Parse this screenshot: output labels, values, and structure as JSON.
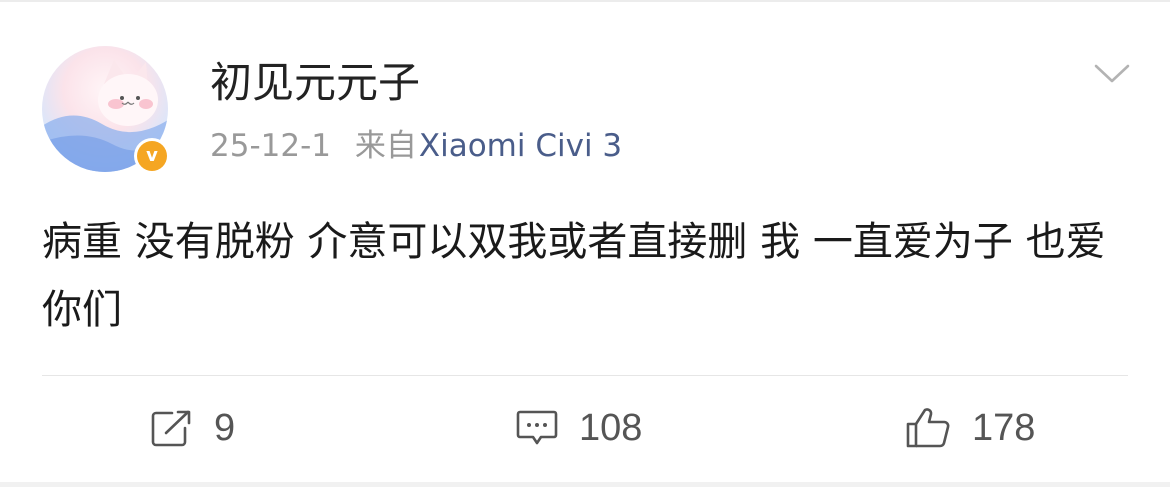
{
  "post": {
    "author": {
      "name": "初见元元子",
      "verified_badge": "v",
      "avatar_icon": "cat-avatar"
    },
    "meta": {
      "date": "25-12-1",
      "from_label": "来自",
      "device": "Xiaomi Civi 3"
    },
    "text": "病重 没有脱粉 介意可以双我或者直接删 我 一直爱为子 也爱你们",
    "actions": {
      "repost_count": "9",
      "comment_count": "108",
      "like_count": "178"
    }
  },
  "colors": {
    "text": "#1a1a1a",
    "meta": "#999999",
    "device": "#4a5d8a",
    "verified": "#f5a623",
    "icon": "#555555"
  }
}
